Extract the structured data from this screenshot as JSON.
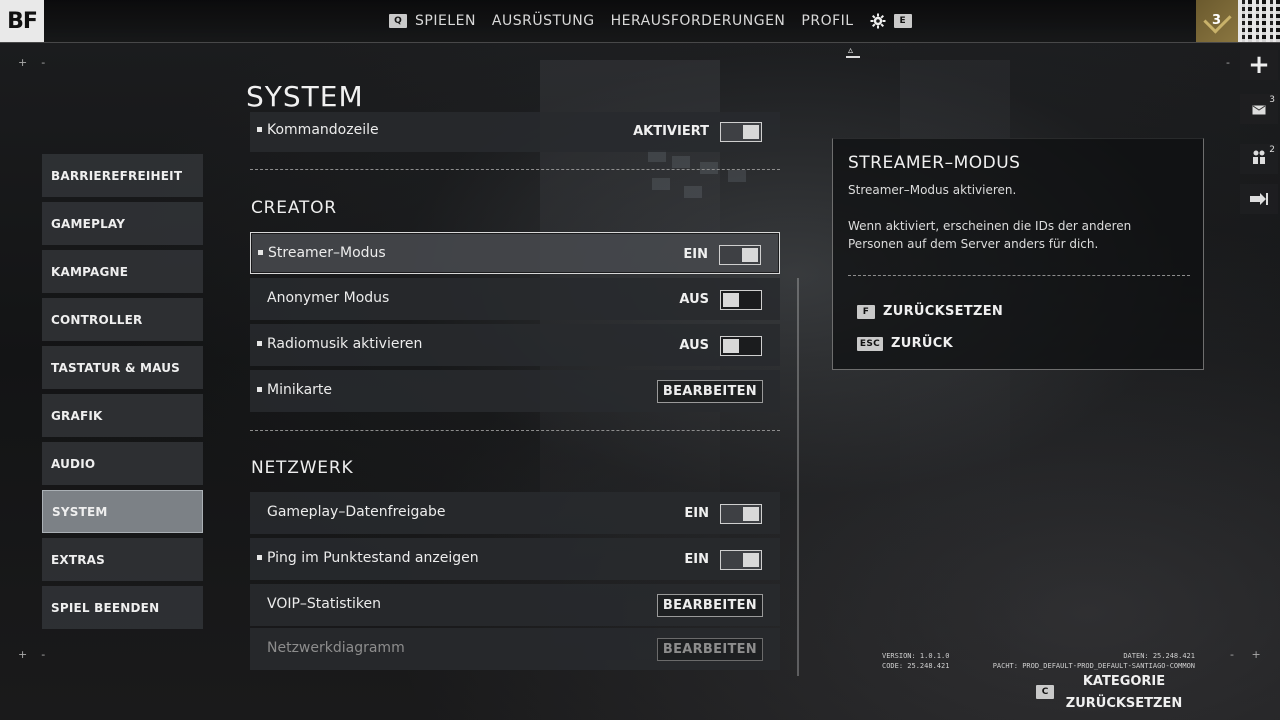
{
  "logo": "BF",
  "nav": {
    "left_key": "Q",
    "items": [
      "SPIELEN",
      "AUSRÜSTUNG",
      "HERAUSFORDERUNGEN",
      "PROFIL"
    ],
    "right_key": "E",
    "settings_icon": "gear-icon"
  },
  "rank": {
    "level": "3"
  },
  "rail": {
    "add_icon": "plus-icon",
    "messages_badge": "3",
    "friends_badge": "2",
    "exit_icon": "exit-icon"
  },
  "page_title": "SYSTEM",
  "sidebar": {
    "items": [
      "BARRIEREFREIHEIT",
      "GAMEPLAY",
      "KAMPAGNE",
      "CONTROLLER",
      "TASTATUR & MAUS",
      "GRAFIK",
      "AUDIO",
      "SYSTEM",
      "EXTRAS",
      "SPIEL BEENDEN"
    ],
    "active": "SYSTEM"
  },
  "settings": {
    "partial_row": {
      "label": "Kommandozeile",
      "value": "AKTIVIERT",
      "state": "on"
    },
    "creator": {
      "title": "CREATOR",
      "rows": [
        {
          "label": "Streamer–Modus",
          "value": "EIN",
          "state": "on"
        },
        {
          "label": "Anonymer Modus",
          "value": "AUS",
          "state": "off"
        },
        {
          "label": "Radiomusik aktivieren",
          "value": "AUS",
          "state": "off"
        },
        {
          "label": "Minikarte",
          "button": "BEARBEITEN"
        }
      ]
    },
    "network": {
      "title": "NETZWERK",
      "rows": [
        {
          "label": "Gameplay–Datenfreigabe",
          "value": "EIN",
          "state": "on"
        },
        {
          "label": "Ping im Punktestand anzeigen",
          "value": "EIN",
          "state": "on"
        },
        {
          "label": "VOIP–Statistiken",
          "button": "BEARBEITEN"
        },
        {
          "label": "Netzwerkdiagramm",
          "button": "BEARBEITEN"
        }
      ]
    }
  },
  "info_panel": {
    "title": "STREAMER–MODUS",
    "subtitle": "Streamer–Modus aktivieren.",
    "description": "Wenn aktiviert, erscheinen die IDs der anderen Personen auf dem Server anders für dich.",
    "actions": [
      {
        "key": "F",
        "label": "ZURÜCKSETZEN"
      },
      {
        "key": "ESC",
        "label": "ZURÜCK"
      }
    ]
  },
  "footer": {
    "version_line": "VERSION: 1.0.1.0",
    "code_line": "CODE: 25.248.421",
    "data_line": "DATEN: 25.248.421",
    "patch_line": "PACHT: PROD_DEFAULT-PROD_DEFAULT-SANTIAGO-COMMON",
    "reset_key": "C",
    "reset_label_1": "KATEGORIE",
    "reset_label_2": "ZURÜCKSETZEN"
  }
}
